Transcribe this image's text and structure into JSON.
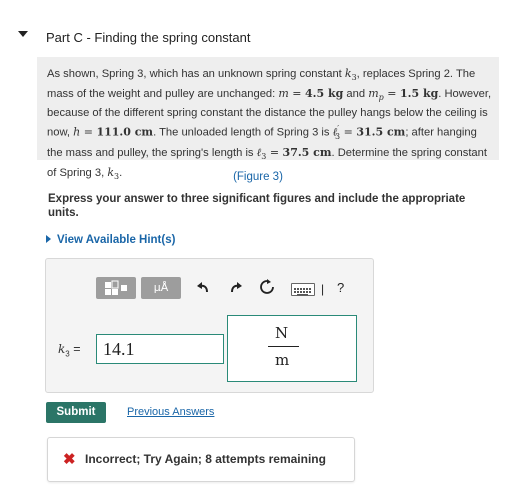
{
  "part": {
    "title": "Part C - Finding the spring constant"
  },
  "problem": {
    "s1": "As shown, Spring 3, which has an unknown spring constant ",
    "k3": "k",
    "k3_sub": "3",
    "s2": ", replaces Spring 2. The mass of the weight and pulley are unchanged: ",
    "m_sym": "m",
    "m_eq": " = ",
    "m_val": "4.5 kg",
    "s3": " and ",
    "mp_sym": "m",
    "mp_sub": "p",
    "mp_eq": " = ",
    "mp_val": "1.5 kg",
    "s4": ". However, because of the different spring constant the distance the pulley hangs below the ceiling is now, ",
    "h_sym": "h",
    "h_eq": " = ",
    "h_val": "111.0 cm",
    "s5": ". The unloaded length of Spring 3 is ",
    "l0_sym": "ℓ",
    "l0_sup": "′",
    "l0_sub": "3",
    "l0_eq": " = ",
    "l0_val": "31.5 cm",
    "s6": "; after hanging the mass and pulley, the spring's length is ",
    "l3_sym": "ℓ",
    "l3_sub": "3",
    "l3_eq": " = ",
    "l3_val": "37.5 cm",
    "s7": ". Determine the spring constant of Spring 3, ",
    "k3b": "k",
    "k3b_sub": "3",
    "s8": "."
  },
  "figure_link": "(Figure 3)",
  "instruction": "Express your answer to three significant figures and include the appropriate units.",
  "hints": {
    "label": "View Available Hint(s)"
  },
  "toolbar": {
    "mu_label": "μÅ",
    "kbd_bar": "|",
    "help": "?"
  },
  "answer": {
    "var_letter": "k",
    "var_sub": "3",
    "equals": " =",
    "value": "14.1",
    "unit_numerator": "N",
    "unit_denominator": "m"
  },
  "actions": {
    "submit": "Submit",
    "previous_answers": "Previous Answers"
  },
  "feedback": {
    "icon": "✖",
    "text": "Incorrect; Try Again; 8 attempts remaining"
  }
}
